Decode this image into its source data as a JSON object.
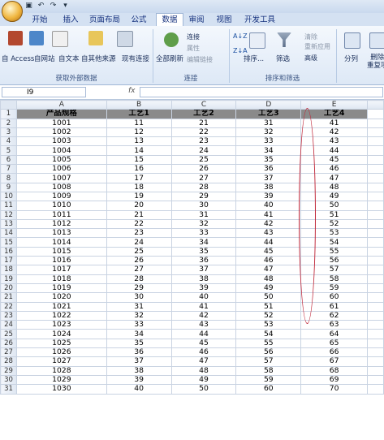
{
  "ribbon": {
    "tabs": [
      "开始",
      "插入",
      "页面布局",
      "公式",
      "数据",
      "审阅",
      "视图",
      "开发工具"
    ],
    "active_tab": "数据",
    "external_data": {
      "buttons": [
        "自 Access",
        "自网站",
        "自文本",
        "自其他来源",
        "现有连接"
      ],
      "label": "获取外部数据"
    },
    "connections": {
      "refresh_all": "全部刷新",
      "items": [
        "连接",
        "属性",
        "编辑链接"
      ],
      "label": "连接"
    },
    "sort_filter": {
      "sort": "排序...",
      "filter": "筛选",
      "items": [
        "清除",
        "重新应用",
        "高级"
      ],
      "label": "排序和筛选"
    },
    "split": "分列",
    "remove_dup": "删除\n重复项",
    "az": "A↓Z",
    "za": "Z↓A"
  },
  "formula_bar": {
    "name_box": "I9",
    "fx": "fx",
    "formula": ""
  },
  "sheet": {
    "col_headers": [
      "A",
      "B",
      "C",
      "D",
      "E"
    ],
    "headers": [
      "产品规格",
      "工艺1",
      "工艺2",
      "工艺3",
      "工艺4"
    ],
    "rows": [
      [
        "1001",
        "11",
        "21",
        "31",
        "41"
      ],
      [
        "1002",
        "12",
        "22",
        "32",
        "42"
      ],
      [
        "1003",
        "13",
        "23",
        "33",
        "43"
      ],
      [
        "1004",
        "14",
        "24",
        "34",
        "44"
      ],
      [
        "1005",
        "15",
        "25",
        "35",
        "45"
      ],
      [
        "1006",
        "16",
        "26",
        "36",
        "46"
      ],
      [
        "1007",
        "17",
        "27",
        "37",
        "47"
      ],
      [
        "1008",
        "18",
        "28",
        "38",
        "48"
      ],
      [
        "1009",
        "19",
        "29",
        "39",
        "49"
      ],
      [
        "1010",
        "20",
        "30",
        "40",
        "50"
      ],
      [
        "1011",
        "21",
        "31",
        "41",
        "51"
      ],
      [
        "1012",
        "22",
        "32",
        "42",
        "52"
      ],
      [
        "1013",
        "23",
        "33",
        "43",
        "53"
      ],
      [
        "1014",
        "24",
        "34",
        "44",
        "54"
      ],
      [
        "1015",
        "25",
        "35",
        "45",
        "55"
      ],
      [
        "1016",
        "26",
        "36",
        "46",
        "56"
      ],
      [
        "1017",
        "27",
        "37",
        "47",
        "57"
      ],
      [
        "1018",
        "28",
        "38",
        "48",
        "58"
      ],
      [
        "1019",
        "29",
        "39",
        "49",
        "59"
      ],
      [
        "1020",
        "30",
        "40",
        "50",
        "60"
      ],
      [
        "1021",
        "31",
        "41",
        "51",
        "61"
      ],
      [
        "1022",
        "32",
        "42",
        "52",
        "62"
      ],
      [
        "1023",
        "33",
        "43",
        "53",
        "63"
      ],
      [
        "1024",
        "34",
        "44",
        "54",
        "64"
      ],
      [
        "1025",
        "35",
        "45",
        "55",
        "65"
      ],
      [
        "1026",
        "36",
        "46",
        "56",
        "66"
      ],
      [
        "1027",
        "37",
        "47",
        "57",
        "67"
      ],
      [
        "1028",
        "38",
        "48",
        "58",
        "68"
      ],
      [
        "1029",
        "39",
        "49",
        "59",
        "69"
      ],
      [
        "1030",
        "40",
        "50",
        "60",
        "70"
      ]
    ]
  },
  "colors": {
    "header_fill": "#8a8a8a",
    "annotation": "#c0283a",
    "ribbon": "#dde8f6"
  }
}
